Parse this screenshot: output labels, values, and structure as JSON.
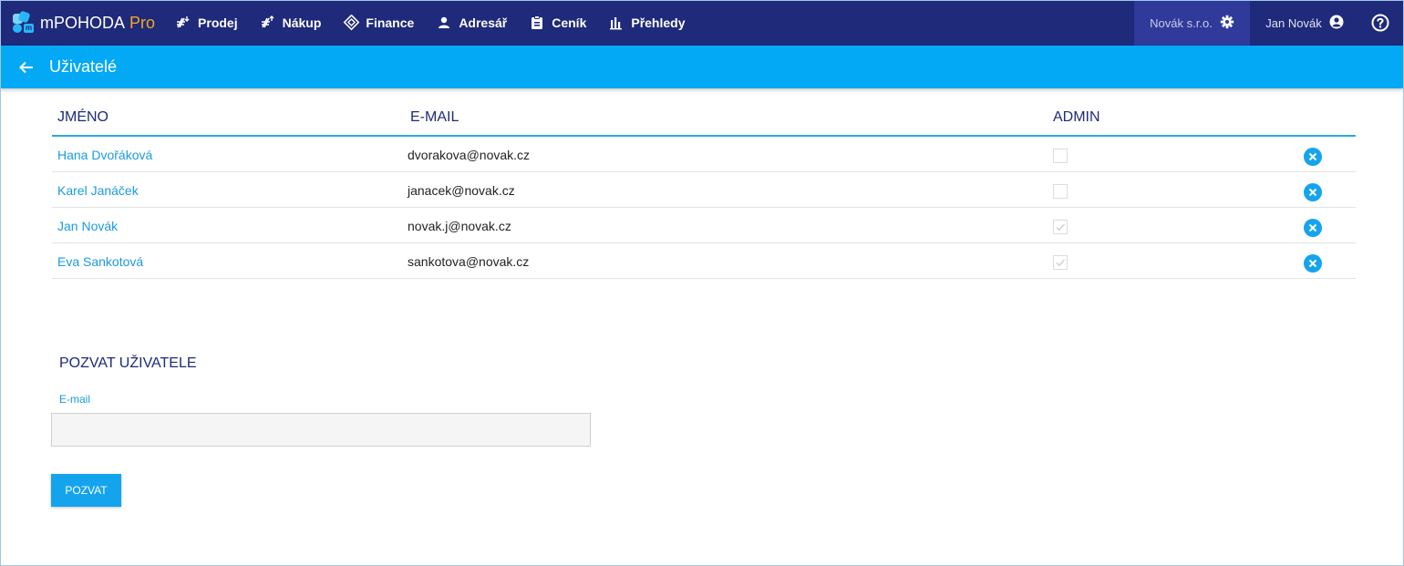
{
  "app": {
    "logo_text": "mPOHODA",
    "logo_suffix": "Pro",
    "logo_mark": "m"
  },
  "nav": [
    {
      "label": "Prodej",
      "icon": "sales-icon"
    },
    {
      "label": "Nákup",
      "icon": "purchase-icon"
    },
    {
      "label": "Finance",
      "icon": "finance-icon"
    },
    {
      "label": "Adresář",
      "icon": "person-icon"
    },
    {
      "label": "Ceník",
      "icon": "clipboard-icon"
    },
    {
      "label": "Přehledy",
      "icon": "bar-chart-icon"
    }
  ],
  "company": {
    "label": "Novák s.r.o.",
    "icon": "gear-icon"
  },
  "user": {
    "label": "Jan Novák",
    "icon": "account-icon"
  },
  "help_icon": "help-icon",
  "page": {
    "title": "Uživatelé",
    "back_icon": "arrow-left-icon"
  },
  "table": {
    "headers": {
      "name": "JMÉNO",
      "email": "E-MAIL",
      "admin": "ADMIN"
    },
    "rows": [
      {
        "name": "Hana Dvořáková",
        "email": "dvorakova@novak.cz",
        "admin": false
      },
      {
        "name": "Karel Janáček",
        "email": "janacek@novak.cz",
        "admin": false
      },
      {
        "name": "Jan Novák",
        "email": "novak.j@novak.cz",
        "admin": true
      },
      {
        "name": "Eva Sankotová",
        "email": "sankotova@novak.cz",
        "admin": true
      }
    ]
  },
  "invite": {
    "title": "POZVAT UŽIVATELE",
    "email_label": "E-mail",
    "email_value": "",
    "button_label": "POZVAT"
  },
  "colors": {
    "topbar": "#1f2a7a",
    "subbar": "#03a9f4",
    "accent": "#14a4ee",
    "logo_pro": "#f5a623"
  }
}
